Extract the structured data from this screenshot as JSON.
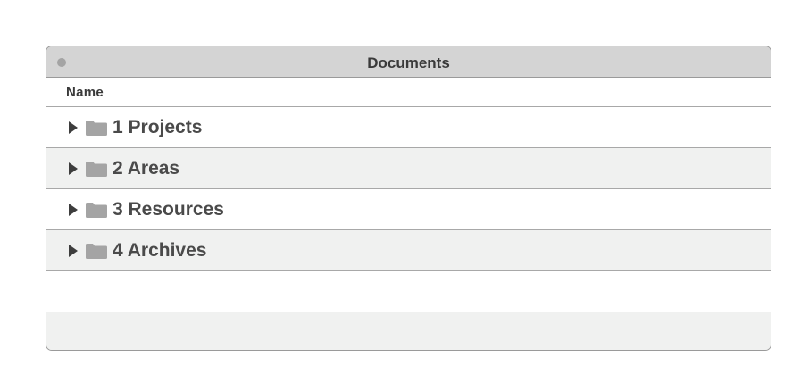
{
  "window": {
    "title": "Documents"
  },
  "table": {
    "column_header": "Name",
    "rows": [
      {
        "label": "1 Projects",
        "icon": "folder-icon",
        "expander": "disclosure-triangle-icon"
      },
      {
        "label": "2 Areas",
        "icon": "folder-icon",
        "expander": "disclosure-triangle-icon"
      },
      {
        "label": "3 Resources",
        "icon": "folder-icon",
        "expander": "disclosure-triangle-icon"
      },
      {
        "label": "4 Archives",
        "icon": "folder-icon",
        "expander": "disclosure-triangle-icon"
      }
    ]
  },
  "colors": {
    "titlebar": "#d4d4d4",
    "row_alt": "#f0f1f0",
    "folder": "#a4a4a4",
    "text": "#4a4a4a"
  }
}
